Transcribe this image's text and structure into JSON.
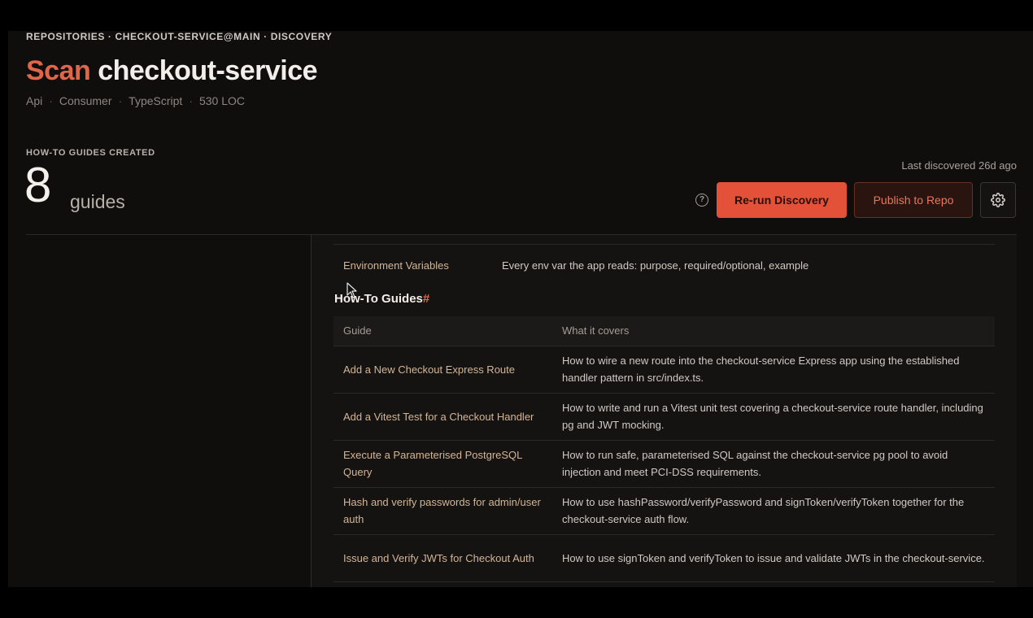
{
  "breadcrumb": "REPOSITORIES · CHECKOUT-SERVICE@MAIN · DISCOVERY",
  "title": {
    "action": "Scan",
    "repo": "checkout-service"
  },
  "meta": [
    "Api",
    "Consumer",
    "TypeScript",
    "530 LOC"
  ],
  "stats": {
    "label": "HOW-TO GUIDES CREATED",
    "count": "8",
    "unit": "guides"
  },
  "last_discovered": "Last discovered 26d ago",
  "actions": {
    "rerun_label": "Re-run Discovery",
    "publish_label": "Publish to Repo",
    "help_icon": "help-circle-icon",
    "settings_icon": "gear-icon"
  },
  "doc": {
    "env_row": {
      "name": "Environment Variables",
      "desc": "Every env var the app reads: purpose, required/optional, example"
    },
    "heading": "How-To Guides",
    "heading_anchor": "#",
    "table": {
      "headers": [
        "Guide",
        "What it covers"
      ],
      "rows": [
        {
          "guide": "Add a New Checkout Express Route",
          "covers": "How to wire a new route into the checkout-service Express app using the established handler pattern in src/index.ts."
        },
        {
          "guide": "Add a Vitest Test for a Checkout Handler",
          "covers": "How to write and run a Vitest unit test covering a checkout-service route handler, including pg and JWT mocking."
        },
        {
          "guide": "Execute a Parameterised PostgreSQL Query",
          "covers": "How to run safe, parameterised SQL against the checkout-service pg pool to avoid injection and meet PCI-DSS requirements."
        },
        {
          "guide": "Hash and verify passwords for admin/user auth",
          "covers": "How to use hashPassword/verifyPassword and signToken/verifyToken together for the checkout-service auth flow."
        },
        {
          "guide": "Issue and Verify JWTs for Checkout Auth",
          "covers": "How to use signToken and verifyToken to issue and validate JWTs in the checkout-service."
        }
      ]
    }
  },
  "colors": {
    "accent": "#e0664a",
    "primary_button": "#e35138",
    "link_text": "#d4b595",
    "background": "#0f0e0d"
  }
}
